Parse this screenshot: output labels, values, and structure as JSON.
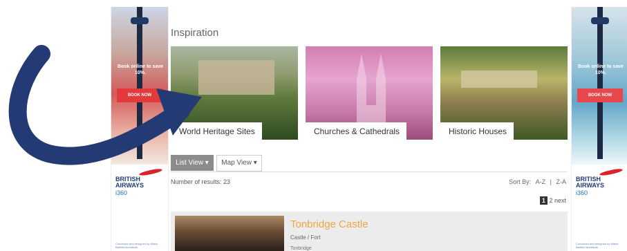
{
  "page": {
    "heading": "Inspiration"
  },
  "tiles": [
    {
      "label": "World Heritage Sites"
    },
    {
      "label": "Churches & Cathedrals"
    },
    {
      "label": "Historic Houses"
    }
  ],
  "views": {
    "list_label": "List View ▾",
    "map_label": "Map View ▾"
  },
  "results": {
    "count_text": "Number of results: 23",
    "sort_label": "Sort By:",
    "sort_az": "A-Z",
    "sort_sep": "|",
    "sort_za": "Z-A",
    "page_current": "1",
    "page_next_num": "2",
    "page_next": "next"
  },
  "result_item": {
    "title": "Tonbridge Castle",
    "type": "Castle / Fort",
    "place": "Tonbridge"
  },
  "ads": {
    "left": {
      "text": "Book online to save 10%.",
      "button": "BOOK NOW",
      "brand": "BRITISH AIRWAYS",
      "sub": "i360",
      "foot": "Conceived and designed by Marks Barfield Architects"
    },
    "right": {
      "text": "Book online to save 10%.",
      "button": "BOOK NOW",
      "brand": "BRITISH AIRWAYS",
      "sub": "i360",
      "foot": "Conceived and designed by Marks Barfield Architects"
    }
  },
  "colors": {
    "arrow": "#233a74",
    "accent_title": "#f0a53d",
    "list_button": "#8c8c8c"
  },
  "icons": {
    "arrow": "curved-arrow-icon"
  }
}
